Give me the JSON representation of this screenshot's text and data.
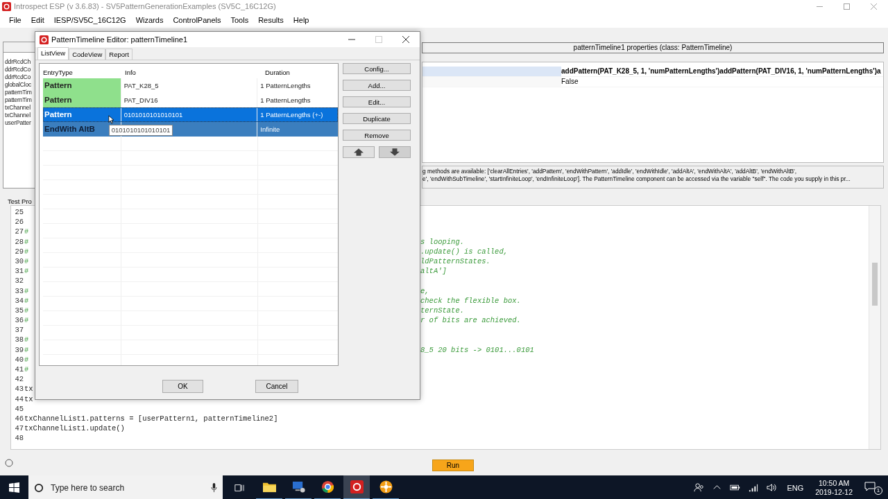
{
  "window": {
    "title": "Introspect ESP (v 3.6.83) - SV5PatternGenerationExamples (SV5C_16C12G)",
    "menu": [
      "File",
      "Edit",
      "IESP/SV5C_16C12G",
      "Wizards",
      "ControlPanels",
      "Tools",
      "Results",
      "Help"
    ]
  },
  "object_tree": {
    "items": [
      "ddrRcdCh",
      "ddrRcdCo",
      "ddrRcdCo",
      "globalCloc",
      "patternTim",
      "patternTim",
      "txChannel",
      "txChannel",
      "userPatter"
    ]
  },
  "properties": {
    "header": "patternTimeline1 properties (class: PatternTimeline)",
    "rows": [
      {
        "value": "addPattern(PAT_K28_5, 1, 'numPatternLengths')addPattern(PAT_DIV16, 1, 'numPatternLengths')a",
        "selected": true,
        "bold": true
      },
      {
        "value": "False",
        "selected": false,
        "bold": false
      }
    ],
    "description": [
      "g methods are available: ['clearAllEntries', 'addPattern', 'endWithPattern', 'addIdle', 'endWithIdle', 'addAltA', 'endWithAltA', 'addAltB', 'endWithAltB',",
      "e', 'endWithSubTimeline', 'startInfiniteLoop', 'endInfiniteLoop']. The PatternTimeline component can be accessed via the variable \"self\". The code you supply in this pr..."
    ]
  },
  "test_procedure": {
    "tab": "Test Pro",
    "lines": [
      {
        "number": "25",
        "kind": "blank"
      },
      {
        "number": "26",
        "kind": "blank"
      },
      {
        "number": "27",
        "kind": "comment",
        "text": "#"
      },
      {
        "number": "28",
        "kind": "comment",
        "text": "#",
        "tail": "s looping."
      },
      {
        "number": "29",
        "kind": "comment",
        "text": "#",
        "tail": ".update() is called,"
      },
      {
        "number": "30",
        "kind": "comment",
        "text": "#",
        "tail": "ldPatternStates."
      },
      {
        "number": "31",
        "kind": "comment",
        "text": "#",
        "tail": "altA']"
      },
      {
        "number": "32",
        "kind": "blank"
      },
      {
        "number": "33",
        "kind": "comment",
        "text": "#",
        "tail": "e,"
      },
      {
        "number": "34",
        "kind": "comment",
        "text": "#",
        "tail": "check the flexible box."
      },
      {
        "number": "35",
        "kind": "comment",
        "text": "#",
        "tail": "ternState."
      },
      {
        "number": "36",
        "kind": "comment",
        "text": "#",
        "tail": "r of bits are achieved."
      },
      {
        "number": "37",
        "kind": "blank"
      },
      {
        "number": "38",
        "kind": "comment",
        "text": "#"
      },
      {
        "number": "39",
        "kind": "comment",
        "text": "#",
        "tail": "8_5 20 bits -> 0101...0101"
      },
      {
        "number": "40",
        "kind": "comment",
        "text": "#"
      },
      {
        "number": "41",
        "kind": "comment",
        "text": "#"
      },
      {
        "number": "42",
        "kind": "blank"
      },
      {
        "number": "43",
        "kind": "code",
        "text": "tx"
      },
      {
        "number": "44",
        "kind": "code",
        "text": "tx"
      },
      {
        "number": "45",
        "kind": "blank"
      },
      {
        "number": "46",
        "kind": "code",
        "text": "txChannelList1.patterns = [userPattern1, patternTimeline2]"
      },
      {
        "number": "47",
        "kind": "code",
        "text": "txChannelList1.update()"
      },
      {
        "number": "48",
        "kind": "blank"
      }
    ]
  },
  "run_button": "Run",
  "dialog": {
    "title": "PatternTimeline Editor: patternTimeline1",
    "tabs": [
      {
        "label": "ListView",
        "selected": true
      },
      {
        "label": "CodeView",
        "selected": false
      },
      {
        "label": "Report",
        "selected": false
      }
    ],
    "columns": [
      "EntryType",
      "Info",
      "Duration"
    ],
    "rows": [
      {
        "entry_type": "Pattern",
        "info": "PAT_K28_5",
        "duration": "1 PatternLengths",
        "selected": false,
        "focused": false
      },
      {
        "entry_type": "Pattern",
        "info": "PAT_DIV16",
        "duration": "1 PatternLengths",
        "selected": false,
        "focused": false
      },
      {
        "entry_type": "Pattern",
        "info": "0101010101010101",
        "duration": "1 PatternLengths (+-)",
        "selected": true,
        "focused": true
      },
      {
        "entry_type": "EndWith AltB",
        "tooltip": "0101010101010101",
        "duration": "Infinite",
        "selected": true,
        "focused": false
      }
    ],
    "buttons": [
      "Config...",
      "Add...",
      "Edit...",
      "Duplicate",
      "Remove"
    ],
    "ok": "OK",
    "cancel": "Cancel"
  },
  "taskbar": {
    "search_placeholder": "Type here to search",
    "apps": [
      {
        "kind": "folder",
        "active": false
      },
      {
        "kind": "monitor",
        "active": false
      },
      {
        "kind": "browser",
        "active": false
      },
      {
        "kind": "introspect",
        "active": true
      },
      {
        "kind": "orange",
        "active": false
      }
    ],
    "language": "ENG",
    "time": "10:50 AM",
    "date": "2019-12-12",
    "notifications": "1"
  }
}
